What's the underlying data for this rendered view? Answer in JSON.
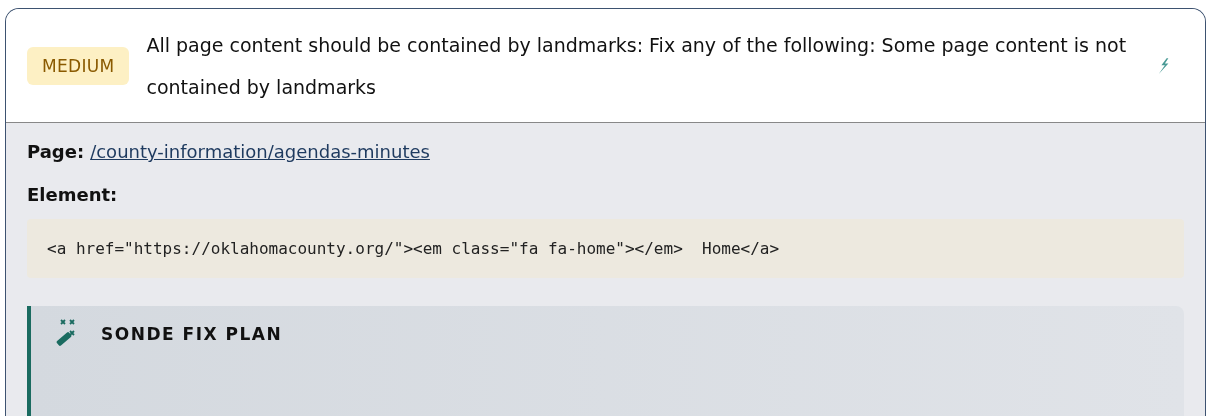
{
  "issue": {
    "severity": "MEDIUM",
    "message": "All page content should be contained by landmarks: Fix any of the following: Some page content is not contained by landmarks"
  },
  "details": {
    "page_label": "Page:",
    "page_link": "/county-information/agendas-minutes",
    "element_label": "Element:",
    "element_code": "<a href=\"https://oklahomacounty.org/\"><em class=\"fa fa-home\"></em>  Home</a>"
  },
  "fix_plan": {
    "title": "SONDE FIX PLAN"
  }
}
